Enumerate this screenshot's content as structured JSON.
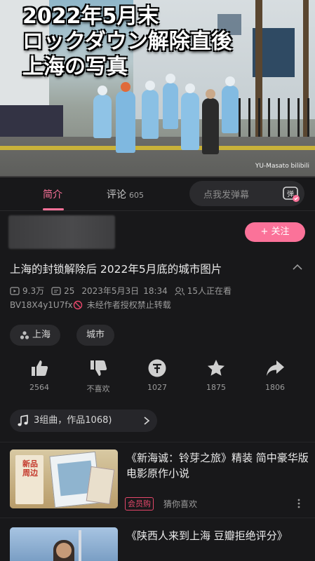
{
  "video": {
    "overlay_title_lines": [
      "2022年5月末",
      "ロックダウン解除直後",
      "上海の写真"
    ],
    "watermark": "YU-Masato bilibili",
    "progress_fraction": 0.0
  },
  "tabs": {
    "intro_label": "简介",
    "comments_label": "评论",
    "comments_count": "605",
    "danmaku_placeholder": "点我发弹幕",
    "danmaku_icon_text": "弹"
  },
  "uploader": {
    "follow_label": "+ 关注"
  },
  "video_info": {
    "title": "上海的封锁解除后  2022年5月底的城市图片",
    "views": "9.3万",
    "danmaku_count": "25",
    "date": "2023年5月3日",
    "time": "18:34",
    "watching": "15人正在看",
    "bvid": "BV18X4y1U7fx",
    "copyright_notice": "未经作者授权禁止转载"
  },
  "tags": [
    {
      "label": "上海"
    },
    {
      "label": "城市"
    }
  ],
  "actions": {
    "like": "2564",
    "dislike": "不喜欢",
    "coin": "1027",
    "favorite": "1875",
    "share": "1806"
  },
  "music": {
    "label": "3组曲，作品1068)"
  },
  "recommendations": [
    {
      "title": "《新海诚：铃芽之旅》精装  简中豪华版  电影原作小说",
      "badge": "会员购",
      "subtitle": "猜你喜欢",
      "thumb_text": "新品周边"
    },
    {
      "title": "《陕西人来到上海  豆瓣拒绝评分》"
    }
  ],
  "colors": {
    "accent": "#fb7299",
    "background": "#18181a",
    "badge": "#e4476a"
  }
}
